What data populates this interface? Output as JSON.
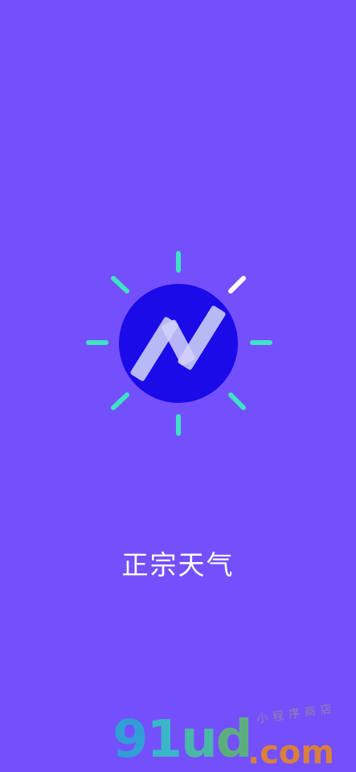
{
  "app": {
    "name": "正宗天气"
  },
  "logo": {
    "icon": "sun-logo-icon",
    "colors": {
      "background": "#7450fd",
      "circle": "#1a0be8",
      "rays": "#3ee3c4",
      "highlight_ray": "#ffffff",
      "mark": "#c8c9f6"
    }
  },
  "watermark": {
    "text_g": "9",
    "text_1": "1",
    "text_u": "u",
    "text_d": "d",
    "text_com": ".com",
    "subtitle": "小程序商店"
  }
}
